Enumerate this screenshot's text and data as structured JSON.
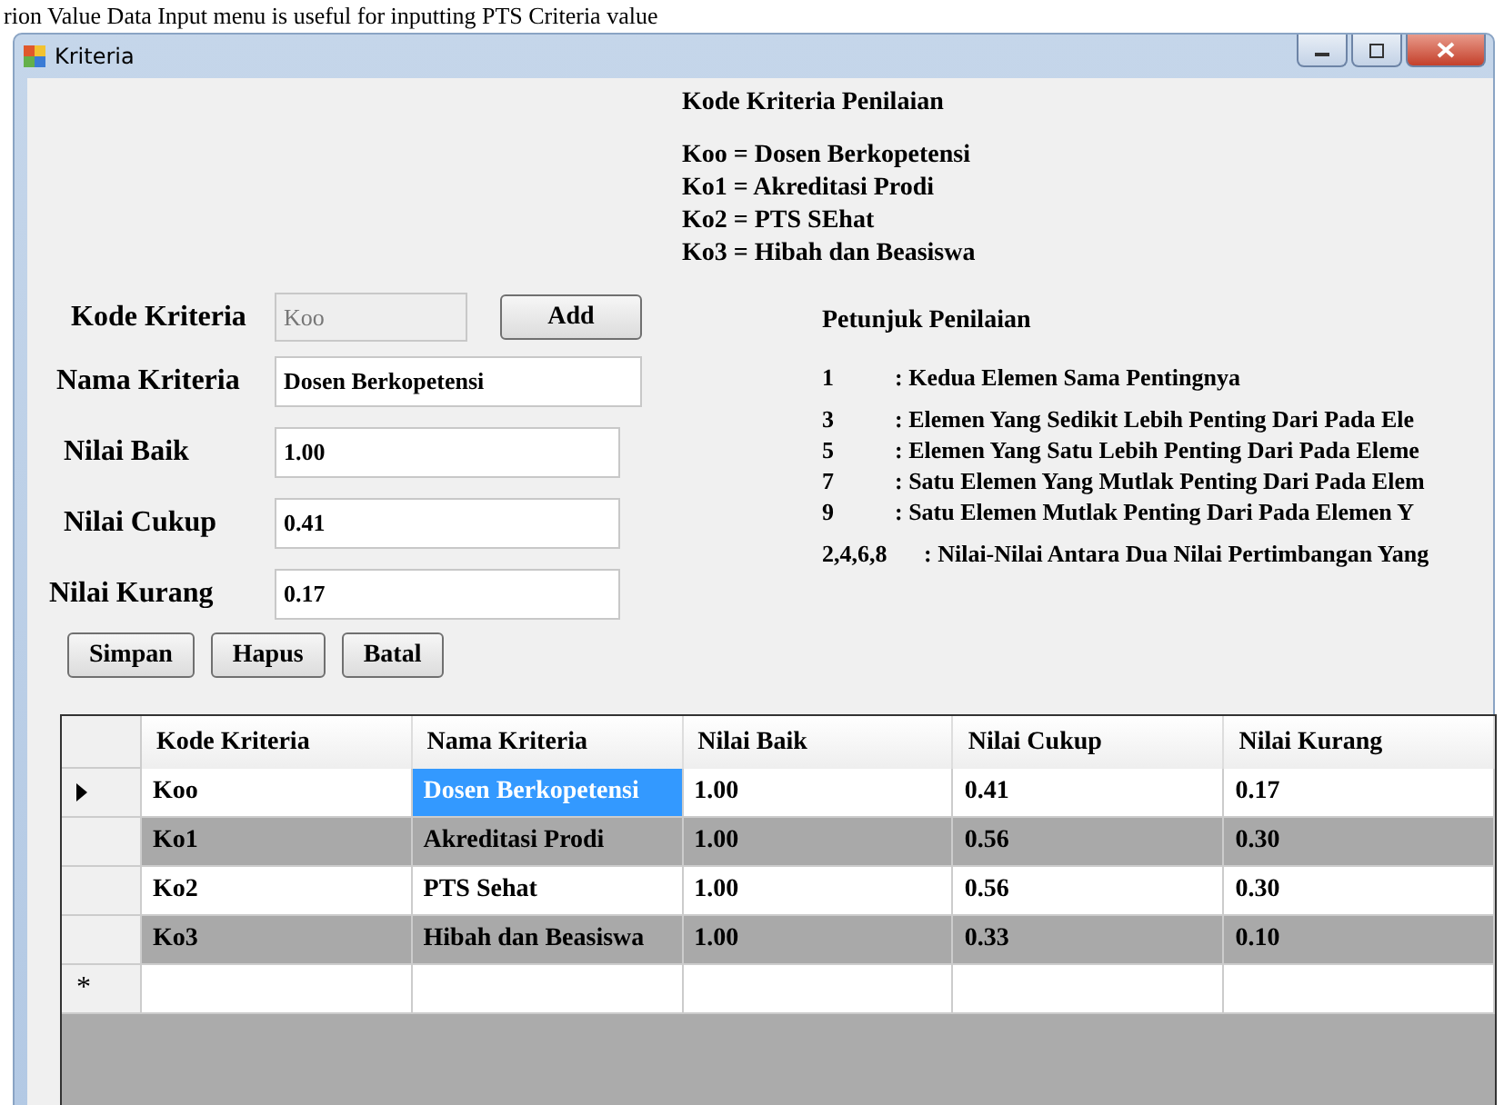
{
  "caption": "rion Value Data Input menu is useful for inputting PTS Criteria value",
  "window": {
    "title": "Kriteria"
  },
  "form": {
    "fields": [
      {
        "label": "Kode Kriteria",
        "value": "Koo",
        "disabled": true
      },
      {
        "label": "Nama Kriteria",
        "value": "Dosen Berkopetensi",
        "disabled": false
      },
      {
        "label": "Nilai Baik",
        "value": "1.00",
        "disabled": false
      },
      {
        "label": "Nilai Cukup",
        "value": "0.41",
        "disabled": false
      },
      {
        "label": "Nilai Kurang",
        "value": "0.17",
        "disabled": false
      }
    ],
    "add_button": "Add",
    "buttons": [
      "Simpan",
      "Hapus",
      "Batal"
    ]
  },
  "legend": {
    "title": "Kode Kriteria Penilaian",
    "lines": [
      "Koo = Dosen Berkopetensi",
      "Ko1  =  Akreditasi Prodi",
      "Ko2  =  PTS SEhat",
      "Ko3  = Hibah dan Beasiswa"
    ]
  },
  "guide": {
    "title": "Petunjuk Penilaian",
    "items": [
      {
        "value": "1",
        "text": ": Kedua Elemen Sama Pentingnya"
      },
      {
        "value": "3",
        "text": ": Elemen Yang Sedikit Lebih Penting Dari Pada Ele"
      },
      {
        "value": "5",
        "text": ": Elemen Yang Satu Lebih Penting Dari Pada Eleme"
      },
      {
        "value": "7",
        "text": ": Satu Elemen Yang Mutlak Penting Dari Pada Elem"
      },
      {
        "value": "9",
        "text": ": Satu Elemen Mutlak Penting Dari Pada Elemen Y"
      },
      {
        "value": "2,4,6,8",
        "text": ": Nilai-Nilai Antara Dua Nilai Pertimbangan Yang"
      }
    ]
  },
  "table": {
    "columns": [
      "Kode Kriteria",
      "Nama Kriteria",
      "Nilai Baik",
      "Nilai Cukup",
      "Nilai Kurang"
    ],
    "rows": [
      {
        "cells": [
          {
            "text": "Koo",
            "selected": false
          },
          {
            "text": "Dosen Berkopetensi",
            "selected": true
          },
          {
            "text": "1.00",
            "selected": false
          },
          {
            "text": "0.41",
            "selected": false
          },
          {
            "text": "0.17",
            "selected": false
          }
        ],
        "current": true,
        "shaded": false
      },
      {
        "cells": [
          {
            "text": "Ko1",
            "selected": false
          },
          {
            "text": "Akreditasi Prodi",
            "selected": false
          },
          {
            "text": "1.00",
            "selected": false
          },
          {
            "text": "0.56",
            "selected": false
          },
          {
            "text": "0.30",
            "selected": false
          }
        ],
        "current": false,
        "shaded": true
      },
      {
        "cells": [
          {
            "text": "Ko2",
            "selected": false
          },
          {
            "text": "PTS Sehat",
            "selected": false
          },
          {
            "text": "1.00",
            "selected": false
          },
          {
            "text": "0.56",
            "selected": false
          },
          {
            "text": "0.30",
            "selected": false
          }
        ],
        "current": false,
        "shaded": false
      },
      {
        "cells": [
          {
            "text": "Ko3",
            "selected": false
          },
          {
            "text": "Hibah dan Beasiswa",
            "selected": false
          },
          {
            "text": "1.00",
            "selected": false
          },
          {
            "text": "0.33",
            "selected": false
          },
          {
            "text": "0.10",
            "selected": false
          }
        ],
        "current": false,
        "shaded": true
      }
    ],
    "new_row_marker": "*"
  }
}
